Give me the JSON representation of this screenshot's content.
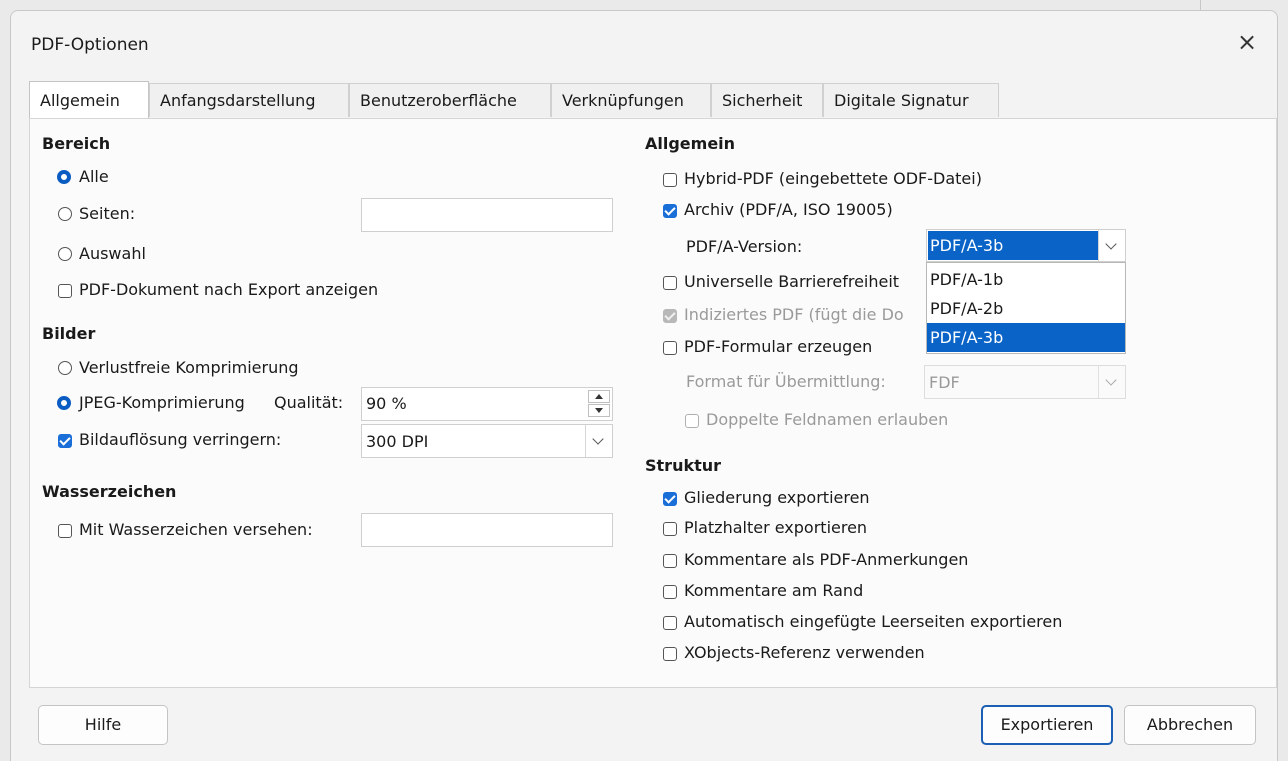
{
  "dialog": {
    "title": "PDF-Optionen",
    "close_icon": "close-icon"
  },
  "tabs": [
    "Allgemein",
    "Anfangsdarstellung",
    "Benutzeroberfläche",
    "Verknüpfungen",
    "Sicherheit",
    "Digitale Signatur"
  ],
  "active_tab": "Allgemein",
  "left": {
    "bereich": {
      "heading": "Bereich",
      "alle": "Alle",
      "seiten": "Seiten:",
      "seiten_value": "",
      "auswahl": "Auswahl",
      "show_pdf": "PDF-Dokument nach Export anzeigen",
      "selected": "Alle"
    },
    "bilder": {
      "heading": "Bilder",
      "lossless": "Verlustfreie Komprimierung",
      "jpeg": "JPEG-Komprimierung",
      "quality_label": "Qualität:",
      "quality_value": "90 %",
      "reduce": "Bildauflösung verringern:",
      "reduce_checked": true,
      "dpi_value": "300 DPI",
      "selected": "JPEG-Komprimierung"
    },
    "wasserzeichen": {
      "heading": "Wasserzeichen",
      "sign": "Mit Wasserzeichen versehen:",
      "value": ""
    }
  },
  "right": {
    "allgemein": {
      "heading": "Allgemein",
      "hybrid": "Hybrid-PDF (eingebettete ODF-Datei)",
      "archiv": "Archiv (PDF/A, ISO 19005)",
      "archiv_checked": true,
      "pdfa_label": "PDF/A-Version:",
      "pdfa_value": "PDF/A-3b",
      "pdfa_options": [
        "PDF/A-1b",
        "PDF/A-2b",
        "PDF/A-3b"
      ],
      "pdfa_selected_option": "PDF/A-3b",
      "ua": "Universelle Barrierefreiheit",
      "indexed": "Indiziertes PDF (fügt die Do",
      "form": "PDF-Formular erzeugen",
      "format_label": "Format für Übermittlung:",
      "format_value": "FDF",
      "dup_names": "Doppelte Feldnamen erlauben"
    },
    "struktur": {
      "heading": "Struktur",
      "outline": "Gliederung exportieren",
      "outline_checked": true,
      "placeholders": "Platzhalter exportieren",
      "comments_pdf": "Kommentare als PDF-Anmerkungen",
      "comments_margin": "Kommentare am Rand",
      "blank_pages": "Automatisch eingefügte Leerseiten exportieren",
      "xobjects": "XObjects-Referenz verwenden"
    }
  },
  "footer": {
    "help": "Hilfe",
    "export": "Exportieren",
    "cancel": "Abbrechen"
  },
  "colors": {
    "accent": "#0a64c8",
    "checkbox_on": "#1a6ed8"
  }
}
